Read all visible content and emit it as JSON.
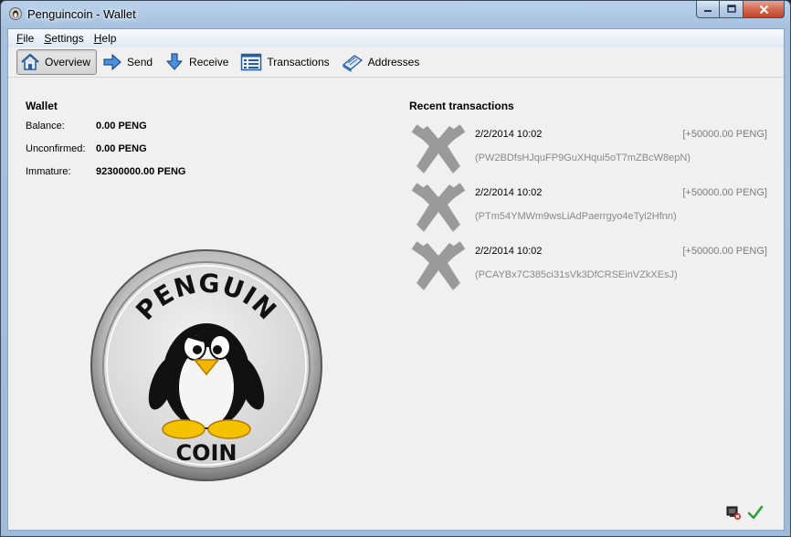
{
  "window": {
    "title": "Penguincoin - Wallet"
  },
  "menu": [
    {
      "prefix": "F",
      "rest": "ile"
    },
    {
      "prefix": "S",
      "rest": "ettings"
    },
    {
      "prefix": "H",
      "rest": "elp"
    }
  ],
  "toolbar": {
    "overview": "Overview",
    "send": "Send",
    "receive": "Receive",
    "transactions": "Transactions",
    "addresses": "Addresses"
  },
  "wallet": {
    "title": "Wallet",
    "balance_label": "Balance:",
    "balance": "0.00 PENG",
    "unconfirmed_label": "Unconfirmed:",
    "unconfirmed": "0.00 PENG",
    "immature_label": "Immature:",
    "immature": "92300000.00 PENG"
  },
  "coin_logo": {
    "top_text": "PENGUIN",
    "bottom_text": "COIN"
  },
  "recent": {
    "title": "Recent transactions",
    "items": [
      {
        "date": "2/2/2014 10:02",
        "amount": "[+50000.00 PENG]",
        "address": "(PW2BDfsHJquFP9GuXHqui5oT7mZBcW8epN)"
      },
      {
        "date": "2/2/2014 10:02",
        "amount": "[+50000.00 PENG]",
        "address": "(PTm54YMWm9wsLiAdPaerrgyo4eTyi2Hfnn)"
      },
      {
        "date": "2/2/2014 10:02",
        "amount": "[+50000.00 PENG]",
        "address": "(PCAYBx7C385ci31sVk3DfCRSEinVZkXEsJ)"
      }
    ]
  },
  "colors": {
    "accent": "#3a7bd5",
    "mined_icon": "#9a9a9a",
    "amount": "#7c7c7c"
  }
}
